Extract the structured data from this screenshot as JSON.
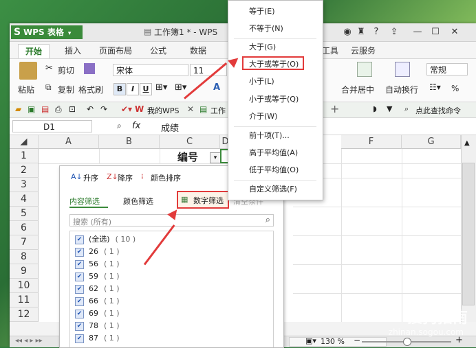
{
  "titlebar": {
    "app_name": "WPS 表格",
    "doc_title": "工作簿1 * - WPS"
  },
  "tabs": [
    "开始",
    "插入",
    "页面布局",
    "公式",
    "数据",
    "工具",
    "云服务"
  ],
  "ribbon": {
    "paste": "粘贴",
    "cut": "剪切",
    "copy": "复制",
    "format_painter": "格式刷",
    "font_name": "宋体",
    "font_size": "11",
    "bold": "B",
    "italic": "I",
    "underline": "U",
    "merge_center": "合并居中",
    "wrap_text": "自动换行",
    "number_format": "常规",
    "percent": "%"
  },
  "qbar": {
    "my_wps": "我的WPS",
    "doc_tab": "工作",
    "search_cmd": "点此查找命令"
  },
  "formula": {
    "cell_ref": "D1",
    "fx": "fx",
    "value": "成绩"
  },
  "grid": {
    "columns": [
      "A",
      "B",
      "C",
      "D",
      "E",
      "F",
      "G"
    ],
    "rows": [
      "1",
      "2",
      "3",
      "4",
      "5",
      "6",
      "7",
      "8",
      "9",
      "10",
      "11",
      "12"
    ],
    "c1_value": "编号"
  },
  "filter_panel": {
    "sort_asc": "升序",
    "sort_desc": "降序",
    "color_sort": "颜色排序",
    "tab_content": "内容筛选",
    "tab_color": "颜色筛选",
    "tab_number": "数字筛选",
    "clear": "清空条件",
    "search_placeholder": "搜索 (所有)",
    "items": [
      {
        "label": "(全选)",
        "count": "( 10 )"
      },
      {
        "label": "26",
        "count": "( 1 )"
      },
      {
        "label": "56",
        "count": "( 1 )"
      },
      {
        "label": "59",
        "count": "( 1 )"
      },
      {
        "label": "62",
        "count": "( 1 )"
      },
      {
        "label": "66",
        "count": "( 1 )"
      },
      {
        "label": "69",
        "count": "( 1 )"
      },
      {
        "label": "78",
        "count": "( 1 )"
      },
      {
        "label": "87",
        "count": "( 1 )"
      }
    ]
  },
  "menu": {
    "items": [
      "等于(E)",
      "不等于(N)",
      "大于(G)",
      "大于或等于(O)",
      "小于(L)",
      "小于或等于(Q)",
      "介于(W)",
      "前十项(T)...",
      "高于平均值(A)",
      "低于平均值(O)",
      "自定义筛选(F)"
    ]
  },
  "status": {
    "zoom": "130 %"
  },
  "watermark": {
    "brand": "搜狗指南",
    "url": "zhinan.sogou.com"
  },
  "colors": {
    "accent_green": "#3a8a3a",
    "highlight_red": "#e23b3b"
  }
}
